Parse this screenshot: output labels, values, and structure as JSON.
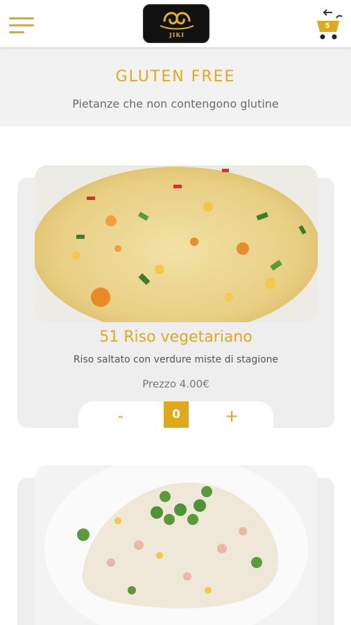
{
  "header": {
    "menu_icon": "hamburger-menu-icon",
    "logo_text": "JIKI",
    "cart_icon": "cart-icon",
    "cart_count": "5"
  },
  "section": {
    "title": "GLUTEN FREE",
    "subtitle": "Pietanze che non contengono glutine"
  },
  "items": [
    {
      "title": "51 Riso vegetariano",
      "description": "Riso saltato con verdure miste di stagione",
      "price": "Prezzo 4.00€",
      "minus_label": "-",
      "quantity": "0",
      "plus_label": "+"
    }
  ],
  "colors": {
    "accent": "#e0a91c",
    "banner_bg": "#f2f2f2",
    "card_bg": "#eeeeee"
  }
}
